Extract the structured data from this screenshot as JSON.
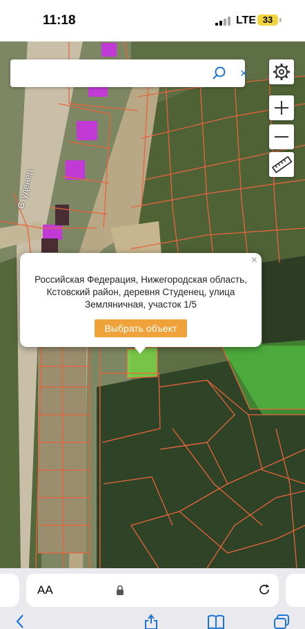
{
  "status_bar": {
    "time": "11:18",
    "network": "LTE",
    "battery": "33"
  },
  "map": {
    "search": {
      "value": "",
      "placeholder": ""
    },
    "place_label": "Студенец",
    "controls": [
      "settings-icon",
      "zoom-in-icon",
      "zoom-out-icon",
      "ruler-icon"
    ],
    "colors": {
      "parcel_outline": "#e8643c",
      "building": "#c13ad6",
      "selected_parcel": "#7cd34a"
    }
  },
  "popup": {
    "address_lines": [
      "Российская Федерация, Нижегородская область,",
      "Кстовский район, деревня Студенец, улица",
      "Земляничная, участок 1/5"
    ],
    "close_label": "×",
    "select_button": "Выбрать объект"
  },
  "browser": {
    "text_size_label": "AA",
    "icons": [
      "lock-icon",
      "reload-icon",
      "back-icon",
      "share-icon",
      "bookmarks-icon",
      "tabs-icon"
    ]
  }
}
